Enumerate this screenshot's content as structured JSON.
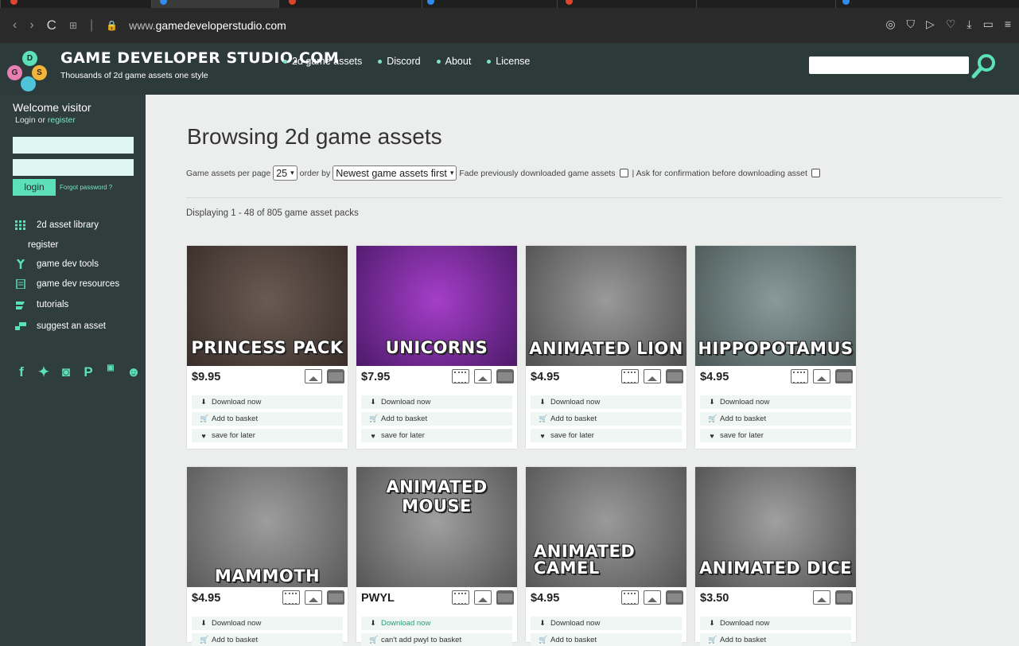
{
  "browser": {
    "url_domain": "www.gamedeveloperstudio.com",
    "url_prefix": "www.",
    "url_host": "gamedeveloperstudio.com"
  },
  "header": {
    "title": "GAME DEVELOPER STUDIO.COM",
    "subtitle": "Thousands of 2d game assets one style",
    "logo_letters": [
      "D",
      "G",
      "S"
    ],
    "nav": [
      "2d game assets",
      "Discord",
      "About",
      "License"
    ],
    "search_placeholder": ""
  },
  "sidebar": {
    "welcome": "Welcome visitor",
    "login_prefix": "Login or",
    "register_link": "register",
    "login_button": "login",
    "forgot_password": "Forgot password ?",
    "items": [
      {
        "label": "2d asset library",
        "icon": "grid-icon"
      },
      {
        "label": "register",
        "icon": ""
      },
      {
        "label": "game dev tools",
        "icon": "slingshot-icon"
      },
      {
        "label": "game dev resources",
        "icon": "document-icon"
      },
      {
        "label": "tutorials",
        "icon": "book-icon"
      },
      {
        "label": "suggest an asset",
        "icon": "chat-icon"
      }
    ],
    "social": [
      "f",
      "🐦",
      "📷",
      "P",
      "You Tube",
      "discord"
    ]
  },
  "main": {
    "heading": "Browsing 2d game assets",
    "per_page_label": "Game assets per page",
    "per_page_value": "25",
    "order_by_label": "order by",
    "order_by_value": "Newest game assets first",
    "fade_label": "Fade previously downloaded game assets",
    "confirm_label": "| Ask for confirmation before downloading asset",
    "displaying": "Displaying 1 - 48 of 805 game asset packs"
  },
  "cards": [
    {
      "title": "PRINCESS PACK",
      "price": "$9.95",
      "icons": [
        "pic",
        "folder"
      ],
      "actions": [
        "Download now",
        "Add to basket",
        "save for later"
      ],
      "colors": [
        "#6a5a52",
        "#3a2e2a"
      ]
    },
    {
      "title": "UNICORNS",
      "price": "$7.95",
      "icons": [
        "film",
        "pic",
        "folder"
      ],
      "actions": [
        "Download now",
        "Add to basket",
        "save for later"
      ],
      "colors": [
        "#a53ec9",
        "#4d1a6a"
      ]
    },
    {
      "title": "ANIMATED LION",
      "price": "$4.95",
      "icons": [
        "film",
        "pic",
        "folder"
      ],
      "actions": [
        "Download now",
        "Add to basket",
        "save for later"
      ],
      "colors": [
        "#9a9a9a",
        "#505050"
      ]
    },
    {
      "title": "HIPPOPOTAMUS",
      "price": "$4.95",
      "icons": [
        "film",
        "pic",
        "folder"
      ],
      "actions": [
        "Download now",
        "Add to basket",
        "save for later"
      ],
      "colors": [
        "#8a9999",
        "#4a5858"
      ]
    },
    {
      "title": "MAMMOTH",
      "price": "$4.95",
      "icons": [
        "film",
        "pic",
        "folder"
      ],
      "actions": [
        "Download now",
        "Add to basket"
      ],
      "colors": [
        "#9d9d9d",
        "#5a5a5a"
      ]
    },
    {
      "title": "ANIMATED MOUSE",
      "price": "PWYL",
      "icons": [
        "film",
        "pic",
        "folder"
      ],
      "actions": [
        "Download now",
        "can't add pwyl to basket"
      ],
      "colors": [
        "#a0a0a0",
        "#555555"
      ]
    },
    {
      "title": "ANIMATED CAMEL",
      "price": "$4.95",
      "icons": [
        "film",
        "pic",
        "folder"
      ],
      "actions": [
        "Download now",
        "Add to basket"
      ],
      "colors": [
        "#9a9a9a",
        "#555555"
      ]
    },
    {
      "title": "ANIMATED DICE",
      "price": "$3.50",
      "icons": [
        "pic",
        "folder"
      ],
      "actions": [
        "Download now",
        "Add to basket"
      ],
      "colors": [
        "#a0a0a0",
        "#505050"
      ]
    }
  ],
  "colors": {
    "accent": "#5ce0b9",
    "header_bg": "#2d3a3a",
    "sidebar_bg": "#303d3d",
    "page_bg": "#eceeed"
  }
}
